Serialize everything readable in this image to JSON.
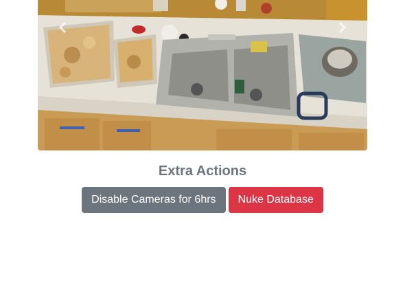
{
  "carousel": {
    "prev_icon": "chevron-left-icon",
    "next_icon": "chevron-right-icon",
    "colors": {
      "counter": "#e8e4dc",
      "cabinet": "#c89a52",
      "wall": "#b8862f",
      "sink": "#a9a9a3"
    }
  },
  "extra_actions": {
    "title": "Extra Actions",
    "buttons": {
      "disable_cameras": "Disable Cameras for 6hrs",
      "nuke_database": "Nuke Database"
    },
    "colors": {
      "title": "#6c757d",
      "secondary": "#6c757d",
      "danger": "#dc3545"
    }
  }
}
